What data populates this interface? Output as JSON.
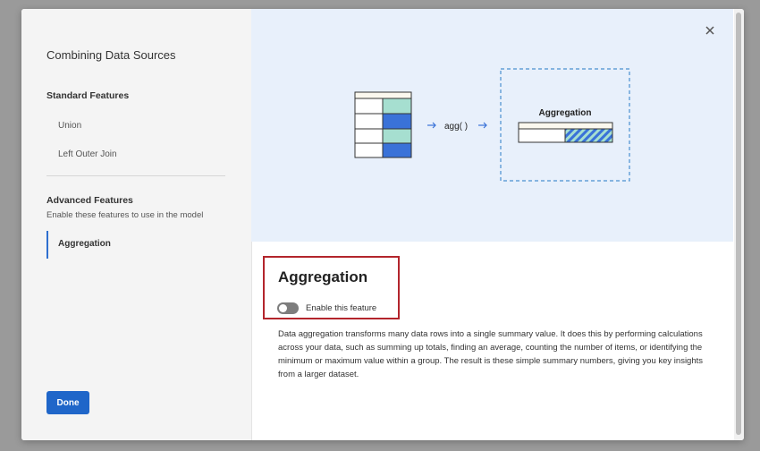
{
  "sidebar": {
    "title": "Combining Data Sources",
    "standard_heading": "Standard Features",
    "standard_items": [
      "Union",
      "Left Outer Join"
    ],
    "advanced_heading": "Advanced Features",
    "advanced_subtitle": "Enable these features to use in the model",
    "active_item": "Aggregation",
    "done_label": "Done"
  },
  "illustration": {
    "function_label": "agg( )",
    "result_label": "Aggregation"
  },
  "content": {
    "title": "Aggregation",
    "toggle_label": "Enable this feature",
    "toggle_on": false,
    "description": "Data aggregation transforms many data rows into a single summary value. It does this by performing calculations across your data, such as summing up totals, finding an average, counting the number of items, or identifying the minimum or maximum value within a group. The result is these simple summary numbers, giving you key insights from a larger dataset."
  },
  "colors": {
    "accent": "#1f66c9",
    "highlight_border": "#b3252c",
    "illustration_bg": "#e8f0fb",
    "mint": "#a6dfd0",
    "blue": "#3a72d8"
  }
}
